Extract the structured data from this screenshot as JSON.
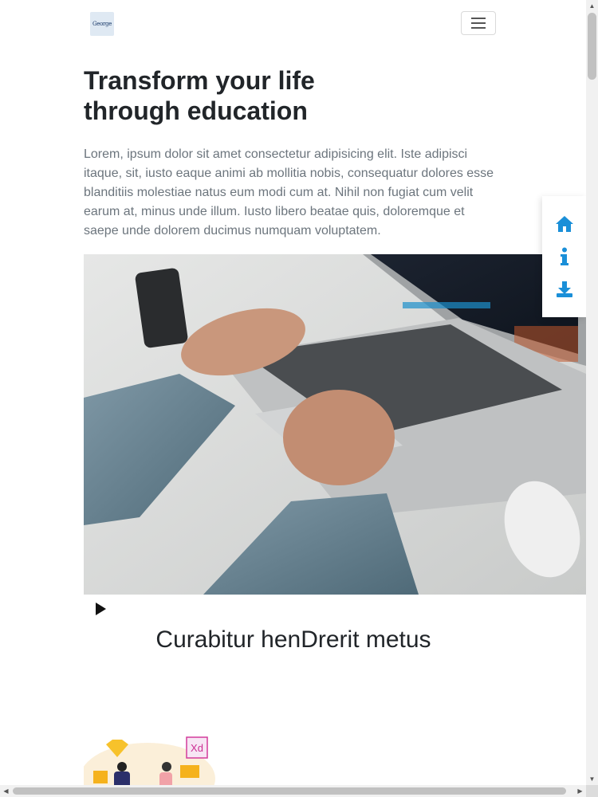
{
  "navbar": {
    "logo_text": "George",
    "toggler_icon": "hamburger-icon"
  },
  "hero": {
    "title": "Transform your life through education",
    "text": "Lorem, ipsum dolor sit amet consectetur adipisicing elit. Iste adipisci itaque, sit, iusto eaque animi ab mollitia nobis, consequatur dolores esse blanditiis molestiae natus eum modi cum at. Nihil non fugiat cum velit earum at, minus unde illum. Iusto libero beatae quis, doloremque et saepe unde dolorem ducimus numquam voluptatem.",
    "image": "laptop-typing-photo"
  },
  "video": {
    "play_icon": "play-icon"
  },
  "section": {
    "title": "Curabitur henDrerit metus"
  },
  "illustration": {
    "badge_text": "Xd"
  },
  "side_nav": {
    "items": [
      {
        "icon": "home-icon"
      },
      {
        "icon": "info-icon"
      },
      {
        "icon": "download-icon"
      }
    ],
    "accent": "#1a8fd8"
  },
  "scrollbar": {
    "arrow_up": "▲",
    "arrow_down": "▼",
    "arrow_left": "◀",
    "arrow_right": "▶"
  }
}
